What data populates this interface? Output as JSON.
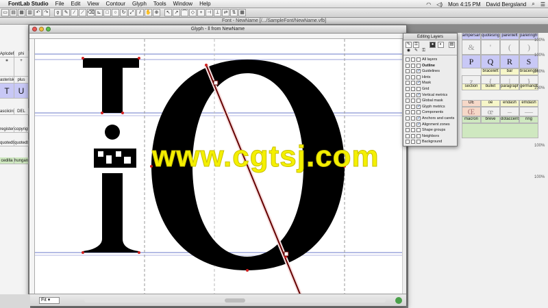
{
  "menubar": {
    "app": "FontLab Studio",
    "items": [
      "File",
      "Edit",
      "View",
      "Contour",
      "Glyph",
      "Tools",
      "Window",
      "Help"
    ],
    "clock": "Mon 4:15 PM",
    "user": "David Bergsland"
  },
  "font_window": {
    "title": "Font - NewName [/.../SampleFont/NewName.vfb]"
  },
  "glyph_window": {
    "title": "Glyph - ll from NewName",
    "zoom": "Fit"
  },
  "layers_panel": {
    "title": "Editing Layers",
    "rows": [
      {
        "label": "All layers",
        "on": false,
        "bold": false
      },
      {
        "label": "Outline",
        "on": false,
        "bold": true
      },
      {
        "label": "Guidelines",
        "on": true,
        "bold": false
      },
      {
        "label": "Hints",
        "on": false,
        "bold": false
      },
      {
        "label": "Mask",
        "on": true,
        "bold": false
      },
      {
        "label": "Grid",
        "on": false,
        "bold": false
      },
      {
        "label": "Vertical metrics",
        "on": true,
        "bold": false
      },
      {
        "label": "Global mask",
        "on": false,
        "bold": false
      },
      {
        "label": "Glyph metrics",
        "on": true,
        "bold": false
      },
      {
        "label": "Components",
        "on": false,
        "bold": false
      },
      {
        "label": "Anchors and carets",
        "on": true,
        "bold": false
      },
      {
        "label": "Alignment zones",
        "on": true,
        "bold": false
      },
      {
        "label": "Shape groups",
        "on": false,
        "bold": false
      },
      {
        "label": "Neighbors",
        "on": false,
        "bold": false
      },
      {
        "label": "Background",
        "on": false,
        "bold": false
      }
    ]
  },
  "left_cells": [
    {
      "cells": [
        "ApIcdef",
        "phi"
      ],
      "color": "#f6f6c8"
    },
    {
      "cells": [
        "asterisk",
        "plus"
      ],
      "color": "#f6f6c8"
    },
    {
      "cells": [
        "T",
        "U"
      ],
      "color": "#c8c8f6"
    },
    {
      "cells": [
        "asciicircle",
        "DEL"
      ],
      "color": "#f6f6c8"
    },
    {
      "cells": [
        "registered",
        "copyright"
      ],
      "color": "#f6f6c8"
    },
    {
      "cells": [
        "quotedbl",
        "quotedbl"
      ],
      "color": "#f6f6c8"
    },
    {
      "cells": [
        "cedilla",
        "hungarum"
      ],
      "color": "#cfe8c0"
    }
  ],
  "right_cells": {
    "row1": [
      "ampersand",
      "quotesingle",
      "parenleft",
      "parenright"
    ],
    "row2": [
      "&",
      "'",
      "(",
      ")"
    ],
    "row3": [
      "P",
      "Q",
      "R",
      "S"
    ],
    "row4": [
      "braceleft",
      "bar",
      "braceright"
    ],
    "row5": [
      "section",
      "bullet",
      "paragraph",
      "germandbls"
    ],
    "row6": [
      "OE",
      "oe",
      "endash",
      "emdash"
    ],
    "row7": [
      "macron",
      "breve",
      "dotaccent",
      "ring"
    ],
    "zoom_labels": [
      "100%",
      "100%",
      "100%",
      "100%",
      "100%",
      "100%"
    ]
  },
  "watermark": "www.cgtsj.com",
  "colors": {
    "accent_yellow": "#f4f000",
    "guide_blue": "#6a78c8",
    "node_red": "#d02020"
  }
}
